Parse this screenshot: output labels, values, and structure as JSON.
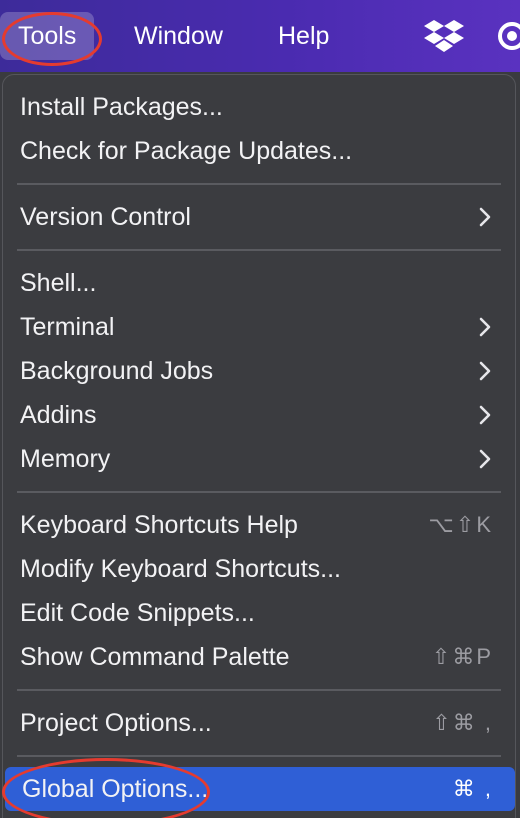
{
  "menubar": {
    "menus": [
      {
        "label": "Tools",
        "active": true
      },
      {
        "label": "Window",
        "active": false
      },
      {
        "label": "Help",
        "active": false
      }
    ],
    "status_icons": [
      "dropbox-icon",
      "creative-cloud-icon"
    ],
    "gradient_colors": [
      "#3d2b9a",
      "#5a32c0"
    ]
  },
  "dropdown": {
    "groups": [
      [
        {
          "label": "Install Packages...",
          "shortcut": "",
          "submenu": false
        },
        {
          "label": "Check for Package Updates...",
          "shortcut": "",
          "submenu": false
        }
      ],
      [
        {
          "label": "Version Control",
          "shortcut": "",
          "submenu": true
        }
      ],
      [
        {
          "label": "Shell...",
          "shortcut": "",
          "submenu": false
        },
        {
          "label": "Terminal",
          "shortcut": "",
          "submenu": true
        },
        {
          "label": "Background Jobs",
          "shortcut": "",
          "submenu": true
        },
        {
          "label": "Addins",
          "shortcut": "",
          "submenu": true
        },
        {
          "label": "Memory",
          "shortcut": "",
          "submenu": true
        }
      ],
      [
        {
          "label": "Keyboard Shortcuts Help",
          "shortcut": "⌥⇧K",
          "submenu": false
        },
        {
          "label": "Modify Keyboard Shortcuts...",
          "shortcut": "",
          "submenu": false
        },
        {
          "label": "Edit Code Snippets...",
          "shortcut": "",
          "submenu": false
        },
        {
          "label": "Show Command Palette",
          "shortcut": "⇧⌘P",
          "submenu": false
        }
      ],
      [
        {
          "label": "Project Options...",
          "shortcut": "⇧⌘ ,",
          "submenu": false
        }
      ],
      [
        {
          "label": "Global Options...",
          "shortcut": "⌘ ,",
          "submenu": false,
          "highlighted": true
        }
      ]
    ],
    "highlight_color": "#2f5fd6",
    "annotation_color": "#e53b2f"
  }
}
